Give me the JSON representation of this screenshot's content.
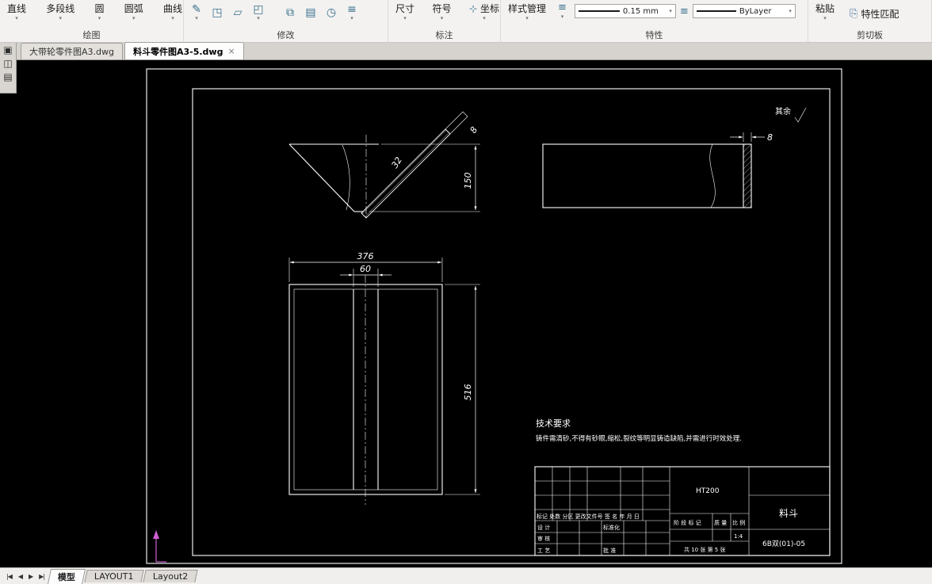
{
  "ribbon": {
    "draw": {
      "label": "绘图",
      "tools": [
        {
          "label": "直线"
        },
        {
          "label": "多段线"
        },
        {
          "label": "圆"
        },
        {
          "label": "圆弧"
        },
        {
          "label": "曲线"
        }
      ]
    },
    "modify": {
      "label": "修改",
      "icons": [
        "✎",
        "◳",
        "▱",
        "◰",
        "⧉",
        "▤",
        "◷",
        "≡"
      ]
    },
    "annotate": {
      "label": "标注",
      "tools": [
        {
          "icon": "",
          "label": "尺寸"
        },
        {
          "icon": "",
          "label": "符号"
        },
        {
          "icon": "⊹",
          "label": "坐标"
        }
      ]
    },
    "properties": {
      "label": "特性",
      "style_manager": "样式管理",
      "lineweight": "0.15 mm",
      "layer_color": "ByLayer"
    },
    "clipboard": {
      "label": "剪切板",
      "paste": "粘贴",
      "match": "特性匹配"
    }
  },
  "doc_tabs": [
    {
      "label": "大带轮零件图A3.dwg"
    },
    {
      "label": "料斗零件图A3-5.dwg",
      "close": "×"
    }
  ],
  "drawing": {
    "surface_note": "其余",
    "dim_150": "150",
    "dim_8_left": "8",
    "dim_32": "32",
    "dim_8_right": "8",
    "dim_376": "376",
    "dim_60": "60",
    "dim_516": "516",
    "tech_title": "技术要求",
    "tech_body": "铸件需清砂,不得有砂眼,缩松,裂纹等明显铸造缺陷,并需进行时效处理.",
    "title_block": {
      "material": "HT200",
      "part_name": "料斗",
      "drawing_no": "6B双(01)-05",
      "rev_header": "标记 处数 分区 更改文件号 签 名 年 月 日",
      "design": "设 计",
      "standardization": "标准化",
      "audit": "审 核",
      "process": "工 艺",
      "approve": "批 准",
      "stage_mark": "阶 段 标 记",
      "weight": "质 量",
      "scale": "比 例",
      "scale_value": "1:4",
      "sheet_info": "共 10 张 第 5 张"
    }
  },
  "status_bar": {
    "nav": [
      "|◀",
      "◀",
      "▶",
      "▶|"
    ],
    "layout_tabs": [
      {
        "label": "模型"
      },
      {
        "label": "LAYOUT1"
      },
      {
        "label": "Layout2"
      }
    ]
  }
}
